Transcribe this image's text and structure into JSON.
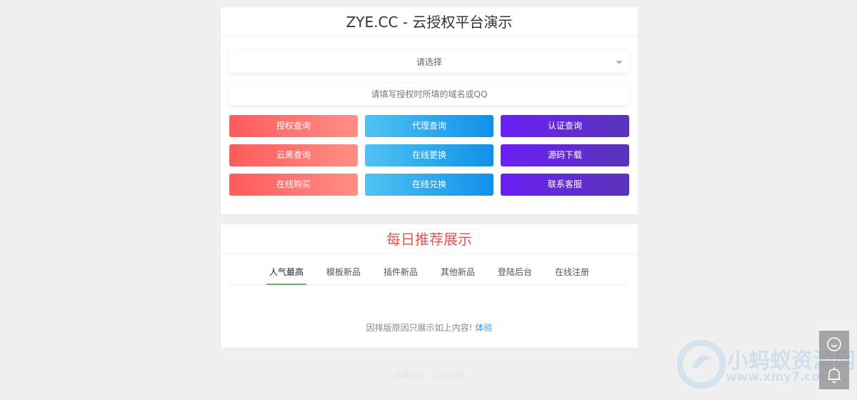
{
  "auth": {
    "title": "ZYE.CC - 云授权平台演示",
    "select_placeholder": "请选择",
    "input_placeholder": "请填写授权时所填的域名或QQ",
    "buttons": [
      {
        "label": "授权查询",
        "style": "red"
      },
      {
        "label": "代理查询",
        "style": "blue"
      },
      {
        "label": "认证查询",
        "style": "purple"
      },
      {
        "label": "云黑查询",
        "style": "red"
      },
      {
        "label": "在线更换",
        "style": "blue"
      },
      {
        "label": "源码下载",
        "style": "purple"
      },
      {
        "label": "在线购买",
        "style": "red"
      },
      {
        "label": "在线兑换",
        "style": "blue"
      },
      {
        "label": "联系客服",
        "style": "purple"
      }
    ]
  },
  "recommend": {
    "title": "每日推荐展示",
    "tabs": [
      "人气最高",
      "模板新品",
      "插件新品",
      "其他新品",
      "登陆后台",
      "在线注册"
    ],
    "active_tab": 0,
    "notice_text": "因排版原因只展示如上内容!",
    "notice_link": "体验"
  },
  "footer": {
    "links": [
      "登录后台",
      "在线注册"
    ]
  },
  "watermark": {
    "line1": "小蚂蚁资源网",
    "line2": "www.xmy7.com"
  },
  "float_buttons": {
    "chat_icon": "chat-bubble-icon",
    "bell_icon": "bell-icon"
  },
  "colors": {
    "accent_red": "#f05050",
    "tab_underline": "#5fb878",
    "link": "#1e9fff"
  }
}
